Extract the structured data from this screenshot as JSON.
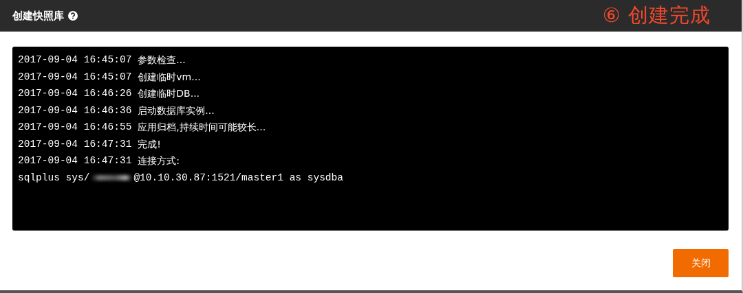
{
  "dialog": {
    "title": "创建快照库",
    "annotation": "⑥ 创建完成"
  },
  "log": {
    "lines": [
      {
        "time": "2017-09-04 16:45:07",
        "message": "参数检查..."
      },
      {
        "time": "2017-09-04 16:45:07",
        "message": "创建临时vm..."
      },
      {
        "time": "2017-09-04 16:46:26",
        "message": "创建临时DB..."
      },
      {
        "time": "2017-09-04 16:46:36",
        "message": "启动数据库实例..."
      },
      {
        "time": "2017-09-04 16:46:55",
        "message": "应用归档,持续时间可能较长..."
      },
      {
        "time": "2017-09-04 16:47:31",
        "message": "完成!"
      },
      {
        "time": "2017-09-04 16:47:31",
        "message": "连接方式:"
      }
    ],
    "command": {
      "before": "sqlplus sys/",
      "after": "@10.10.30.87:1521/master1 as sysdba"
    }
  },
  "buttons": [
    {
      "label": "关闭"
    }
  ]
}
